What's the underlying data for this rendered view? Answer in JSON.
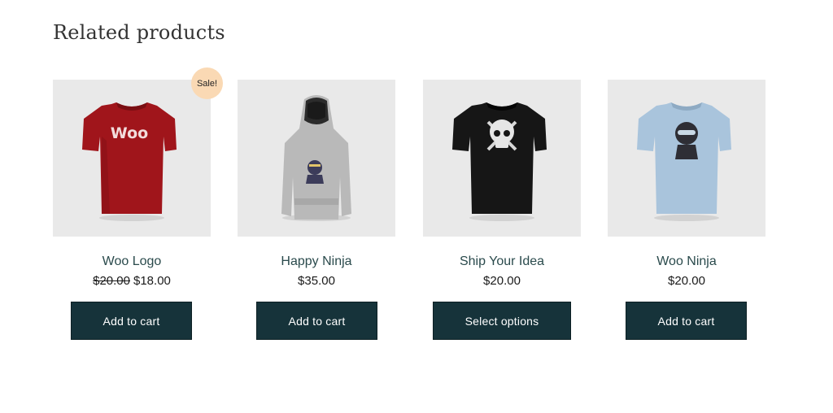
{
  "section": {
    "title": "Related products"
  },
  "colors": {
    "button_bg": "#16333a",
    "card_bg": "#e9e9e9",
    "sale_badge_bg": "#fad9b4",
    "title_link": "#2a4a4c"
  },
  "products": [
    {
      "name": "Woo Logo",
      "regular_price": "$20.00",
      "price": "$18.00",
      "badge": "Sale!",
      "button": "Add to cart",
      "image_icon": "red-tshirt-woo-logo-icon"
    },
    {
      "name": "Happy Ninja",
      "price": "$35.00",
      "button": "Add to cart",
      "image_icon": "gray-hoodie-ninja-icon"
    },
    {
      "name": "Ship Your Idea",
      "price": "$20.00",
      "button": "Select options",
      "image_icon": "black-tshirt-skull-icon"
    },
    {
      "name": "Woo Ninja",
      "price": "$20.00",
      "button": "Add to cart",
      "image_icon": "lightblue-tshirt-ninja-icon"
    }
  ]
}
